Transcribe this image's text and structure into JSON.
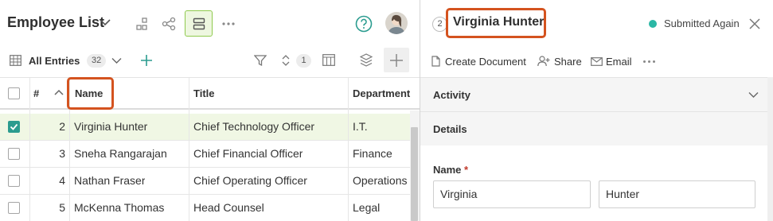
{
  "app": {
    "title": "Employee List"
  },
  "toolbar": {
    "view_label": "All Entries",
    "entry_count": "32",
    "filter_count": "1"
  },
  "grid": {
    "columns": {
      "number": "#",
      "name": "Name",
      "title": "Title",
      "department": "Department"
    },
    "rows": [
      {
        "num": "2",
        "name": "Virginia Hunter",
        "title": "Chief Technology Officer",
        "department": "I.T.",
        "selected": true
      },
      {
        "num": "3",
        "name": "Sneha Rangarajan",
        "title": "Chief Financial Officer",
        "department": "Finance",
        "selected": false
      },
      {
        "num": "4",
        "name": "Nathan Fraser",
        "title": "Chief Operating Officer",
        "department": "Operations",
        "selected": false
      },
      {
        "num": "5",
        "name": "McKenna Thomas",
        "title": "Head Counsel",
        "department": "Legal",
        "selected": false
      }
    ]
  },
  "record": {
    "number": "2",
    "title": "Virginia Hunter",
    "status": "Submitted Again",
    "status_color": "#2bb7a5",
    "actions": {
      "create_document": "Create Document",
      "share": "Share",
      "email": "Email"
    },
    "sections": {
      "activity": "Activity",
      "details": "Details"
    },
    "name_field": {
      "label": "Name",
      "required_mark": "*",
      "first": "Virginia",
      "last": "Hunter"
    }
  },
  "colors": {
    "accent_green": "#8fca4e",
    "checkbox_teal": "#2b9c8f",
    "highlight": "#d4531f"
  },
  "icons": [
    "chevron-down-icon",
    "hierarchy-icon",
    "share-nodes-icon",
    "list-view-icon",
    "more-icon",
    "help-icon",
    "avatar",
    "grid-icon",
    "plus-icon",
    "filter-icon",
    "sort-icon",
    "columns-icon",
    "layers-icon",
    "document-icon",
    "person-add-icon",
    "envelope-icon",
    "close-icon"
  ]
}
